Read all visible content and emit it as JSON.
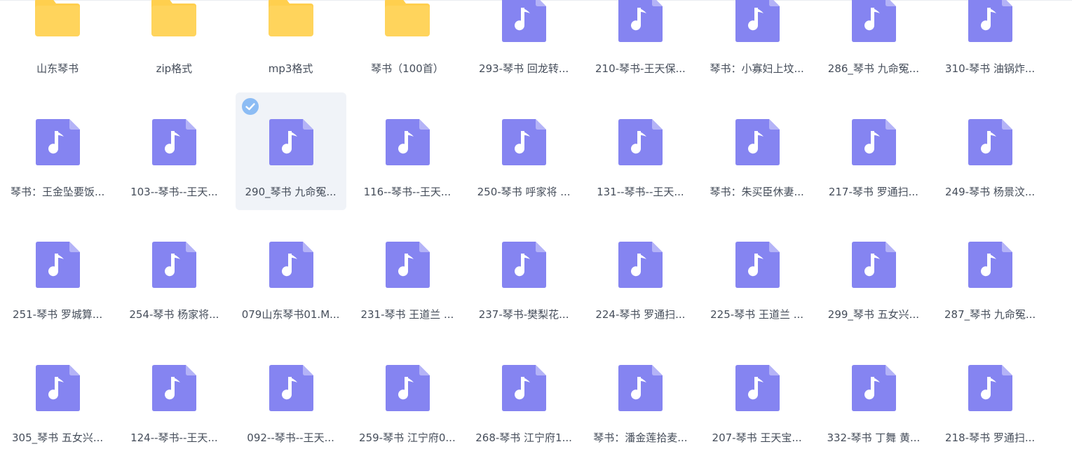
{
  "colors": {
    "folder": "#ffd45c",
    "folder_tab": "#ffcf4e",
    "audio_file": "#8584f1",
    "audio_fold": "#b4b3f7",
    "selected_bg": "#f0f3f8",
    "check_badge": "#8cbcf4",
    "label_text": "#454d5a"
  },
  "icons": {
    "folder": "folder-icon",
    "audio": "music-note-icon",
    "check": "checkmark-icon"
  },
  "files": [
    {
      "name": "山东琴书",
      "type": "folder"
    },
    {
      "name": "zip格式",
      "type": "folder"
    },
    {
      "name": "mp3格式",
      "type": "folder"
    },
    {
      "name": "琴书（100首）",
      "type": "folder"
    },
    {
      "name": "293-琴书 回龙转...",
      "type": "audio"
    },
    {
      "name": "210-琴书-王天保...",
      "type": "audio"
    },
    {
      "name": "琴书：小寡妇上坟...",
      "type": "audio"
    },
    {
      "name": "286_琴书 九命冤...",
      "type": "audio"
    },
    {
      "name": "310-琴书 油锅炸...",
      "type": "audio"
    },
    {
      "name": "琴书：王金坠要饭...",
      "type": "audio"
    },
    {
      "name": "103--琴书--王天...",
      "type": "audio"
    },
    {
      "name": "290_琴书 九命冤...",
      "type": "audio",
      "selected": true
    },
    {
      "name": "116--琴书--王天...",
      "type": "audio"
    },
    {
      "name": "250-琴书 呼家将 ...",
      "type": "audio"
    },
    {
      "name": "131--琴书--王天...",
      "type": "audio"
    },
    {
      "name": "琴书：朱买臣休妻...",
      "type": "audio"
    },
    {
      "name": "217-琴书 罗通扫...",
      "type": "audio"
    },
    {
      "name": "249-琴书 杨景汶...",
      "type": "audio"
    },
    {
      "name": "251-琴书 罗城算...",
      "type": "audio"
    },
    {
      "name": "254-琴书 杨家将...",
      "type": "audio"
    },
    {
      "name": "079山东琴书01.M...",
      "type": "audio"
    },
    {
      "name": "231-琴书 王道兰 ...",
      "type": "audio"
    },
    {
      "name": "237-琴书-樊梨花...",
      "type": "audio"
    },
    {
      "name": "224-琴书 罗通扫...",
      "type": "audio"
    },
    {
      "name": "225-琴书 王道兰 ...",
      "type": "audio"
    },
    {
      "name": "299_琴书 五女兴...",
      "type": "audio"
    },
    {
      "name": "287_琴书 九命冤...",
      "type": "audio"
    },
    {
      "name": "305_琴书 五女兴...",
      "type": "audio"
    },
    {
      "name": "124--琴书--王天...",
      "type": "audio"
    },
    {
      "name": "092--琴书--王天...",
      "type": "audio"
    },
    {
      "name": "259-琴书 江宁府0...",
      "type": "audio"
    },
    {
      "name": "268-琴书 江宁府1...",
      "type": "audio"
    },
    {
      "name": "琴书：潘金莲拾麦...",
      "type": "audio"
    },
    {
      "name": "207-琴书 王天宝...",
      "type": "audio"
    },
    {
      "name": "332-琴书 丁舞 黄...",
      "type": "audio"
    },
    {
      "name": "218-琴书 罗通扫...",
      "type": "audio"
    }
  ]
}
